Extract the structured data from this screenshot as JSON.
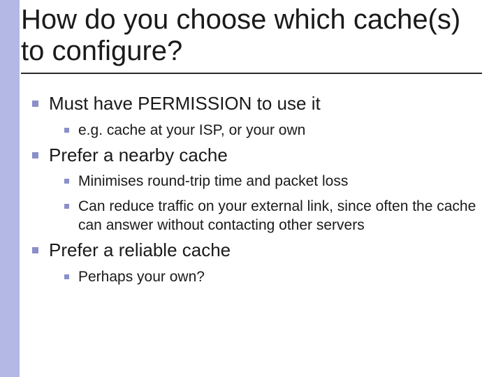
{
  "title": "How do you choose which cache(s) to configure?",
  "bullets": {
    "b1": "Must have PERMISSION to use it",
    "b1_1": "e.g. cache at your ISP, or your own",
    "b2": "Prefer a nearby cache",
    "b2_1": "Minimises round-trip time and packet loss",
    "b2_2": "Can reduce traffic on your external link, since often the cache can answer without contacting other servers",
    "b3": "Prefer a reliable cache",
    "b3_1": "Perhaps your own?"
  }
}
